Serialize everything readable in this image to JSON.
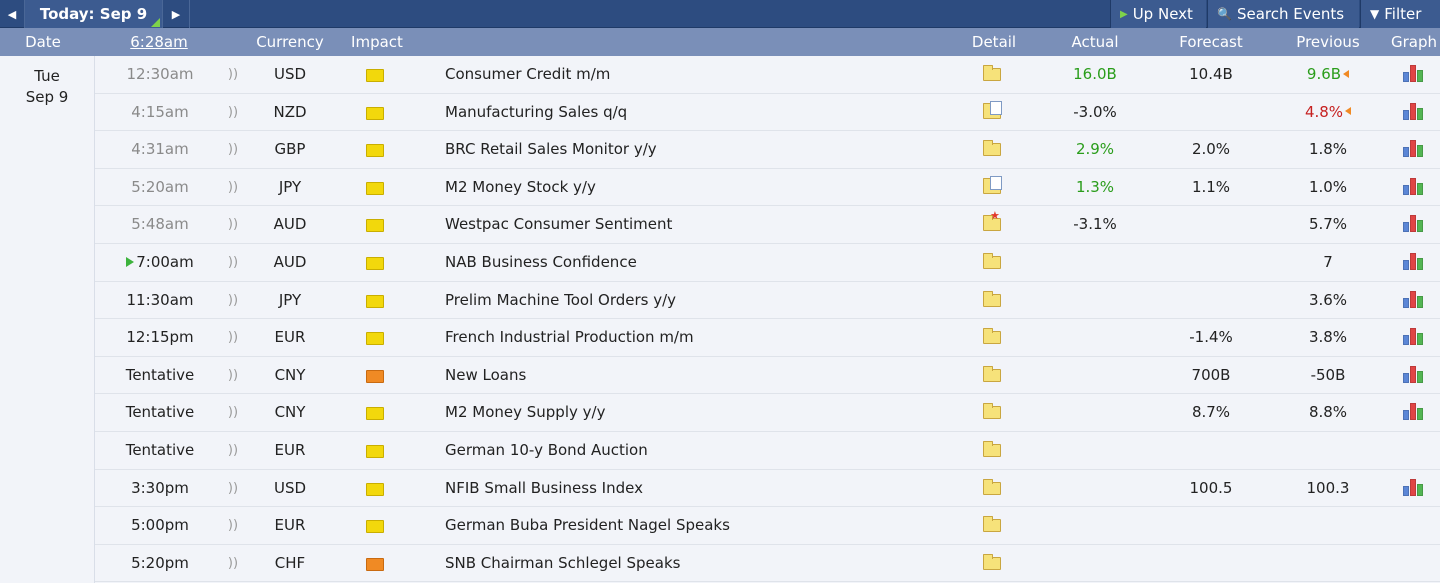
{
  "toolbar": {
    "today_label": "Today: Sep 9",
    "up_next_label": "Up Next",
    "search_label": "Search Events",
    "filter_label": "Filter"
  },
  "columns": {
    "date": "Date",
    "time": "6:28am",
    "currency": "Currency",
    "impact": "Impact",
    "detail": "Detail",
    "actual": "Actual",
    "forecast": "Forecast",
    "previous": "Previous",
    "graph": "Graph"
  },
  "date_cell": {
    "day": "Tue",
    "date": "Sep 9"
  },
  "events": [
    {
      "time": "12:30am",
      "past": true,
      "currency": "USD",
      "impact": "yellow",
      "event": "Consumer Credit m/m",
      "detail_icon": "folder-icon",
      "actual": "16.0B",
      "actual_color": "green",
      "forecast": "10.4B",
      "previous": "9.6B",
      "previous_color": "green",
      "revised": true,
      "graph": true
    },
    {
      "time": "4:15am",
      "past": true,
      "currency": "NZD",
      "impact": "yellow",
      "event": "Manufacturing Sales q/q",
      "detail_icon": "folder-doc-icon",
      "actual": "-3.0%",
      "actual_color": "",
      "forecast": "",
      "previous": "4.8%",
      "previous_color": "red",
      "revised": true,
      "graph": true
    },
    {
      "time": "4:31am",
      "past": true,
      "currency": "GBP",
      "impact": "yellow",
      "event": "BRC Retail Sales Monitor y/y",
      "detail_icon": "folder-icon",
      "actual": "2.9%",
      "actual_color": "green",
      "forecast": "2.0%",
      "previous": "1.8%",
      "previous_color": "",
      "revised": false,
      "graph": true
    },
    {
      "time": "5:20am",
      "past": true,
      "currency": "JPY",
      "impact": "yellow",
      "event": "M2 Money Stock y/y",
      "detail_icon": "folder-doc-icon",
      "actual": "1.3%",
      "actual_color": "green",
      "forecast": "1.1%",
      "previous": "1.0%",
      "previous_color": "",
      "revised": false,
      "graph": true
    },
    {
      "time": "5:48am",
      "past": true,
      "currency": "AUD",
      "impact": "yellow",
      "event": "Westpac Consumer Sentiment",
      "detail_icon": "folder-star-icon",
      "actual": "-3.1%",
      "actual_color": "",
      "forecast": "",
      "previous": "5.7%",
      "previous_color": "",
      "revised": false,
      "graph": true
    },
    {
      "time": "7:00am",
      "past": false,
      "up_next": true,
      "currency": "AUD",
      "impact": "yellow",
      "event": "NAB Business Confidence",
      "detail_icon": "folder-icon",
      "actual": "",
      "actual_color": "",
      "forecast": "",
      "previous": "7",
      "previous_color": "",
      "revised": false,
      "graph": true
    },
    {
      "time": "11:30am",
      "past": false,
      "currency": "JPY",
      "impact": "yellow",
      "event": "Prelim Machine Tool Orders y/y",
      "detail_icon": "folder-icon",
      "actual": "",
      "actual_color": "",
      "forecast": "",
      "previous": "3.6%",
      "previous_color": "",
      "revised": false,
      "graph": true
    },
    {
      "time": "12:15pm",
      "past": false,
      "currency": "EUR",
      "impact": "yellow",
      "event": "French Industrial Production m/m",
      "detail_icon": "folder-icon",
      "actual": "",
      "actual_color": "",
      "forecast": "-1.4%",
      "previous": "3.8%",
      "previous_color": "",
      "revised": false,
      "graph": true
    },
    {
      "time": "Tentative",
      "past": false,
      "currency": "CNY",
      "impact": "orange",
      "event": "New Loans",
      "detail_icon": "folder-icon",
      "actual": "",
      "actual_color": "",
      "forecast": "700B",
      "previous": "-50B",
      "previous_color": "",
      "revised": false,
      "graph": true
    },
    {
      "time": "Tentative",
      "past": false,
      "currency": "CNY",
      "impact": "yellow",
      "event": "M2 Money Supply y/y",
      "detail_icon": "folder-icon",
      "actual": "",
      "actual_color": "",
      "forecast": "8.7%",
      "previous": "8.8%",
      "previous_color": "",
      "revised": false,
      "graph": true
    },
    {
      "time": "Tentative",
      "past": false,
      "currency": "EUR",
      "impact": "yellow",
      "event": "German 10-y Bond Auction",
      "detail_icon": "folder-icon",
      "actual": "",
      "actual_color": "",
      "forecast": "",
      "previous": "",
      "previous_color": "",
      "revised": false,
      "graph": false
    },
    {
      "time": "3:30pm",
      "past": false,
      "currency": "USD",
      "impact": "yellow",
      "event": "NFIB Small Business Index",
      "detail_icon": "folder-icon",
      "actual": "",
      "actual_color": "",
      "forecast": "100.5",
      "previous": "100.3",
      "previous_color": "",
      "revised": false,
      "graph": true
    },
    {
      "time": "5:00pm",
      "past": false,
      "currency": "EUR",
      "impact": "yellow",
      "event": "German Buba President Nagel Speaks",
      "detail_icon": "folder-icon",
      "actual": "",
      "actual_color": "",
      "forecast": "",
      "previous": "",
      "previous_color": "",
      "revised": false,
      "graph": false
    },
    {
      "time": "5:20pm",
      "past": false,
      "currency": "CHF",
      "impact": "orange",
      "event": "SNB Chairman Schlegel Speaks",
      "detail_icon": "folder-icon",
      "actual": "",
      "actual_color": "",
      "forecast": "",
      "previous": "",
      "previous_color": "",
      "revised": false,
      "graph": false
    }
  ]
}
